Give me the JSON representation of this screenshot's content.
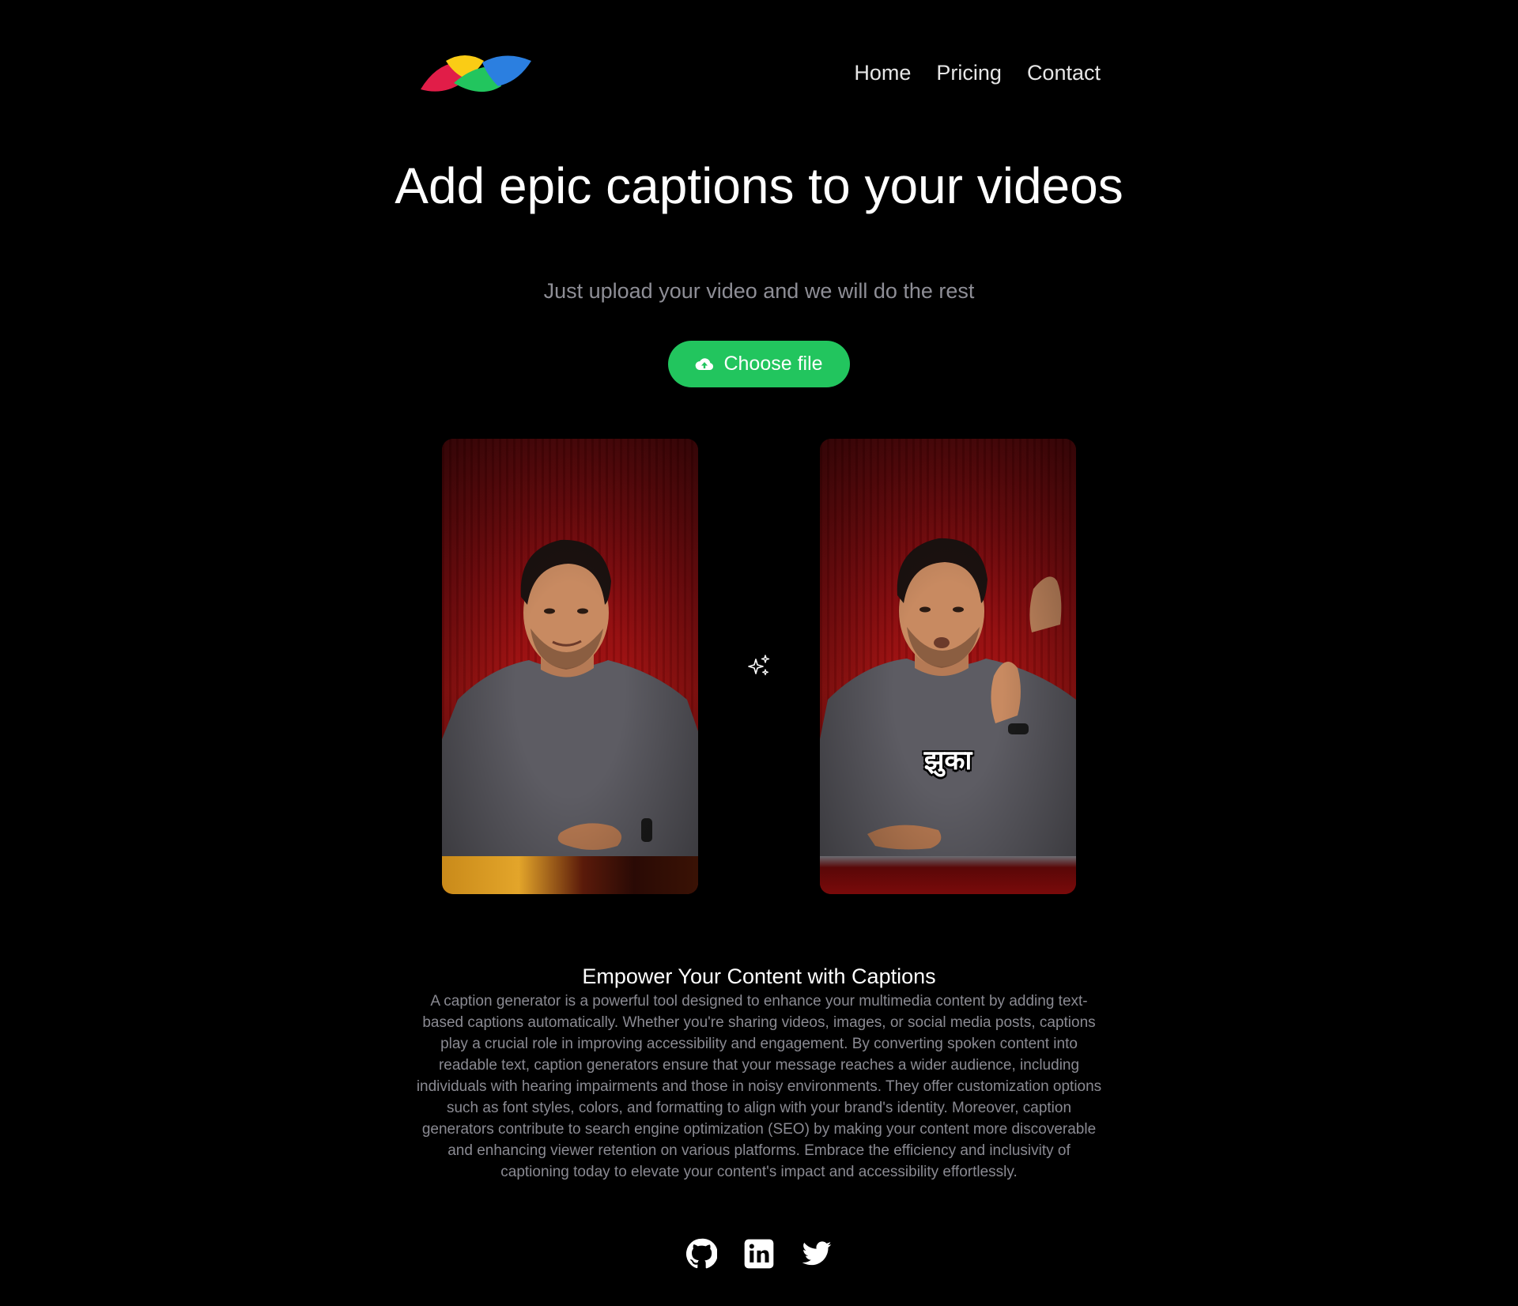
{
  "header": {
    "logo_name": "app-logo",
    "nav": [
      {
        "label": "Home"
      },
      {
        "label": "Pricing"
      },
      {
        "label": "Contact"
      }
    ]
  },
  "hero": {
    "title": "Add epic captions to your videos",
    "subtitle": "Just upload your video and we will do the rest",
    "cta_label": "Choose file",
    "cta_icon": "cloud-upload-icon"
  },
  "preview": {
    "caption_word": "झुका",
    "transform_icon": "sparkles-icon"
  },
  "about": {
    "title": "Empower Your Content with Captions",
    "text": "A caption generator is a powerful tool designed to enhance your multimedia content by adding text-based captions automatically. Whether you're sharing videos, images, or social media posts, captions play a crucial role in improving accessibility and engagement. By converting spoken content into readable text, caption generators ensure that your message reaches a wider audience, including individuals with hearing impairments and those in noisy environments. They offer customization options such as font styles, colors, and formatting to align with your brand's identity. Moreover, caption generators contribute to search engine optimization (SEO) by making your content more discoverable and enhancing viewer retention on various platforms. Embrace the efficiency and inclusivity of captioning today to elevate your content's impact and accessibility effortlessly."
  },
  "footer": {
    "social": [
      "github-icon",
      "linkedin-icon",
      "twitter-icon"
    ]
  },
  "colors": {
    "background": "#000000",
    "accent": "#22c55e",
    "muted_text": "#8a8a92",
    "logo": [
      "#e11d48",
      "#facc15",
      "#22c55e",
      "#2b7fe0"
    ]
  }
}
